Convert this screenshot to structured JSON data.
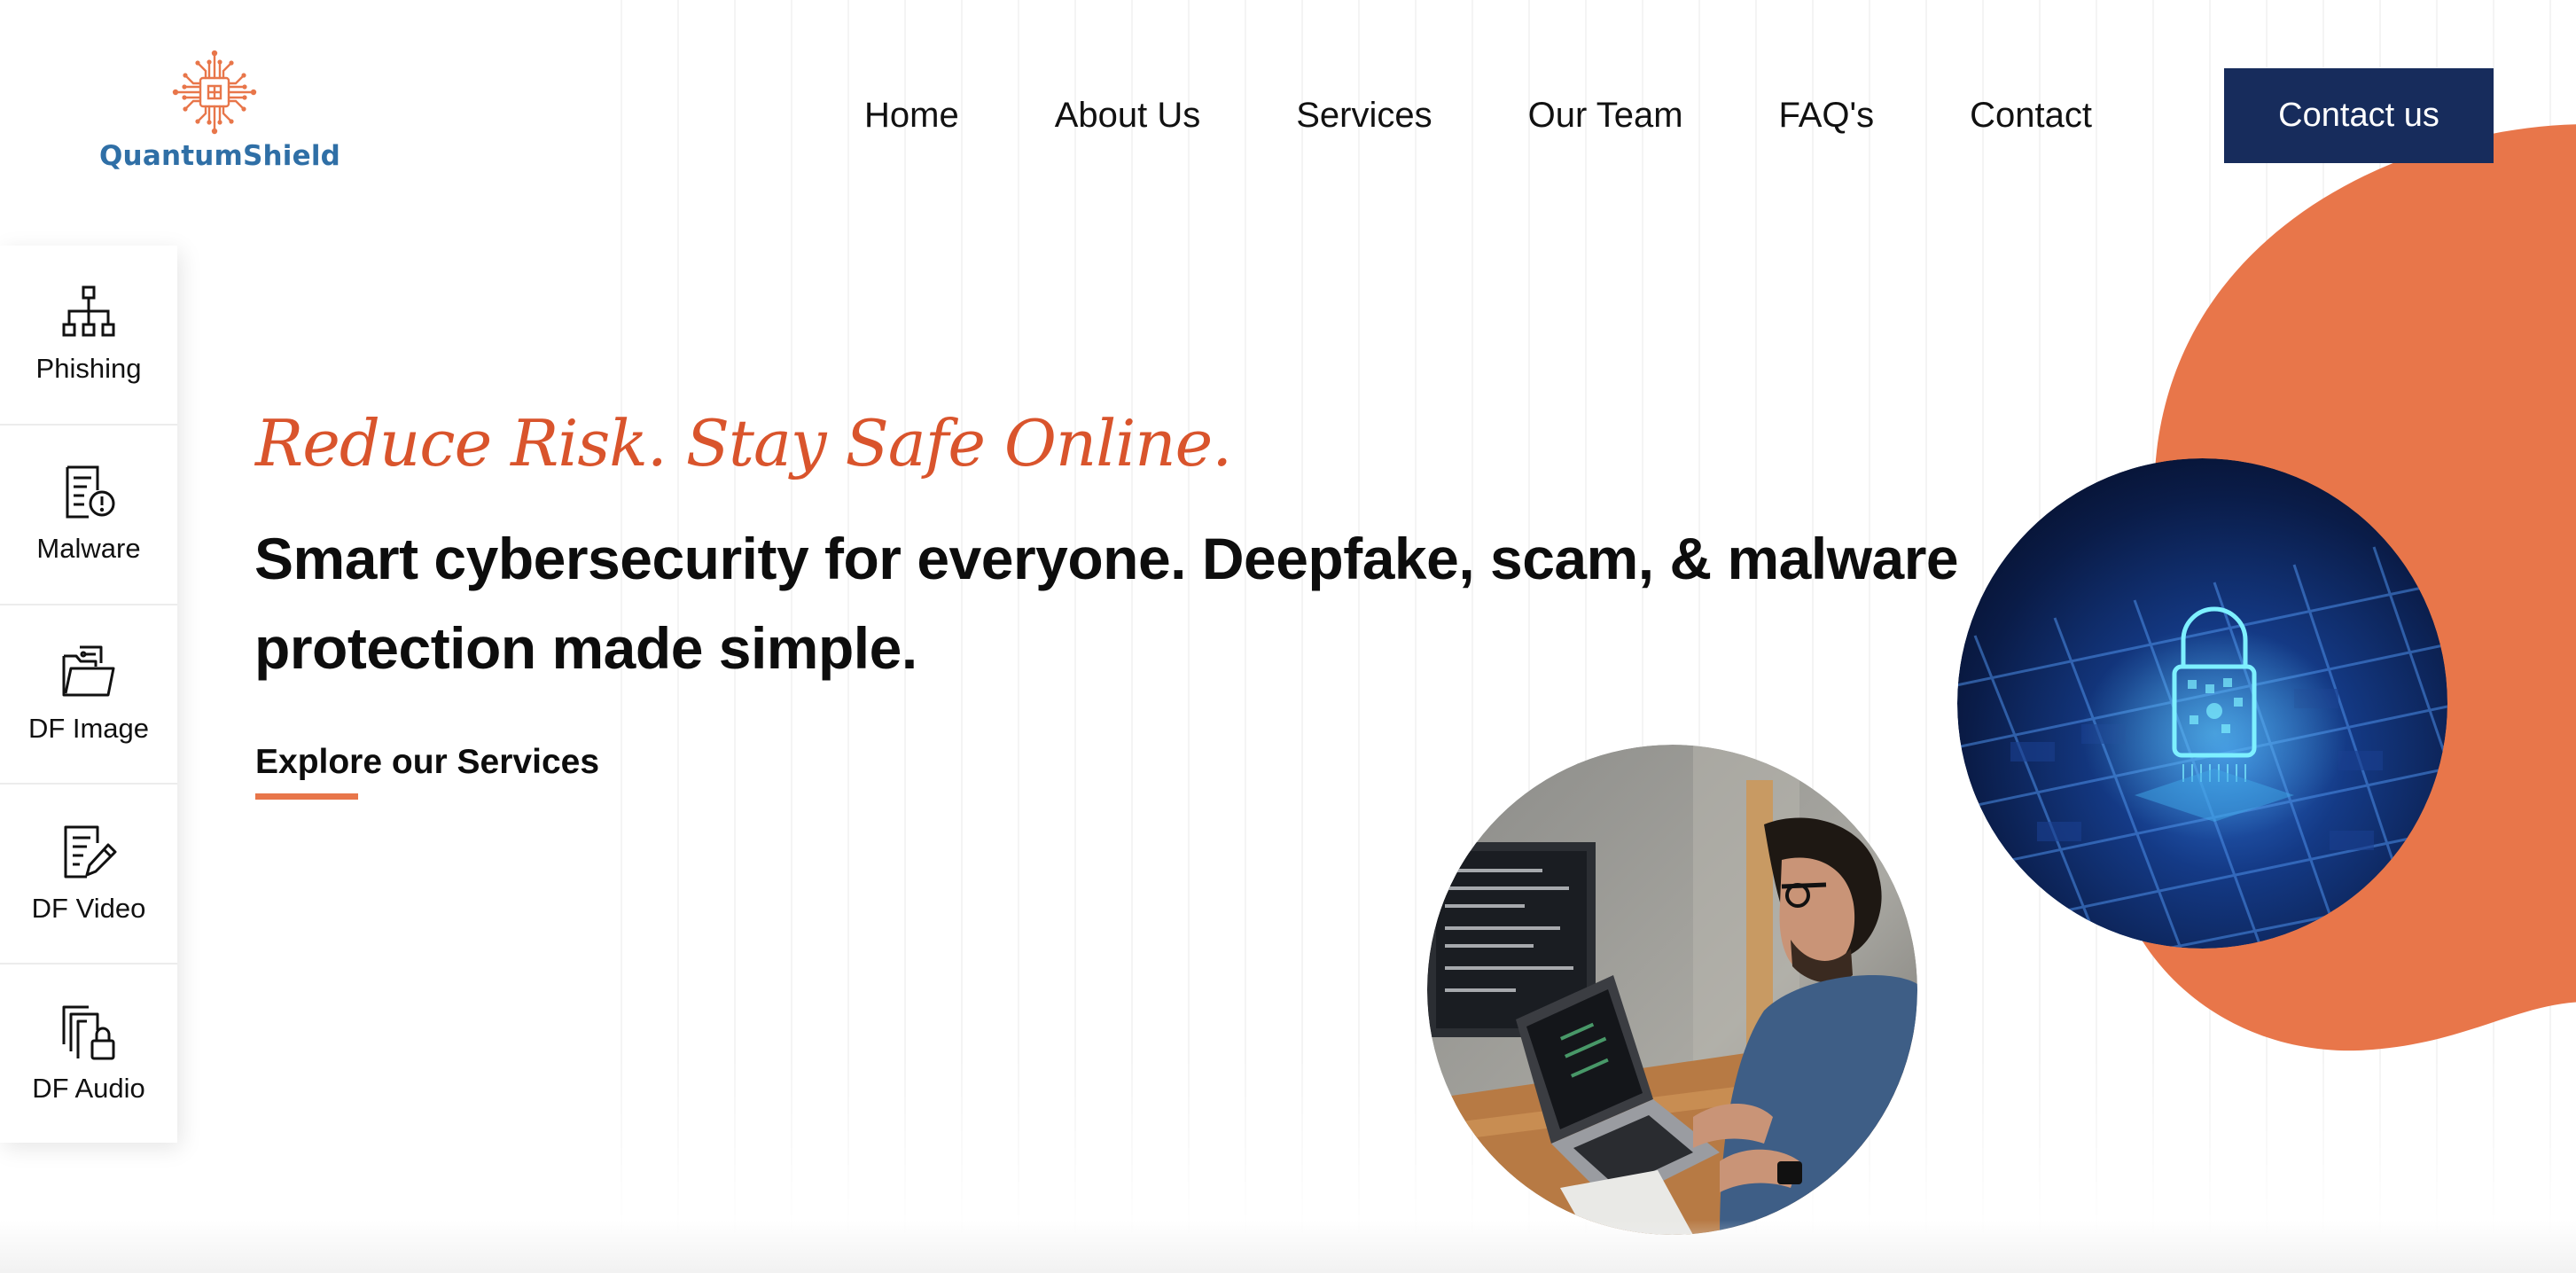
{
  "brand": {
    "name": "QuantumShield",
    "logo_icon": "circuit-chip-icon",
    "logo_color": "#e8764a",
    "text_color": "#2f6fa6"
  },
  "nav": {
    "items": [
      {
        "label": "Home"
      },
      {
        "label": "About Us"
      },
      {
        "label": "Services"
      },
      {
        "label": "Our Team"
      },
      {
        "label": "FAQ's"
      },
      {
        "label": "Contact"
      }
    ],
    "cta_label": "Contact us",
    "cta_color": "#172c5c"
  },
  "sidebar": {
    "items": [
      {
        "label": "Phishing",
        "icon": "sitemap-icon"
      },
      {
        "label": "Malware",
        "icon": "document-alert-icon"
      },
      {
        "label": "DF Image",
        "icon": "image-folder-icon"
      },
      {
        "label": "DF Video",
        "icon": "document-edit-icon"
      },
      {
        "label": "DF Audio",
        "icon": "files-lock-icon"
      }
    ]
  },
  "hero": {
    "tagline": "Reduce Risk. Stay Safe Online.",
    "headline": "Smart cybersecurity for everyone. Deepfake, scam, & malware protection made simple.",
    "cta_link": "Explore our Services",
    "accent_color": "#d9542c",
    "blob_color": "#e8764a"
  },
  "images": {
    "lock_image": "digital-padlock-circuit-image",
    "person_image": "man-coding-on-laptop-image"
  }
}
